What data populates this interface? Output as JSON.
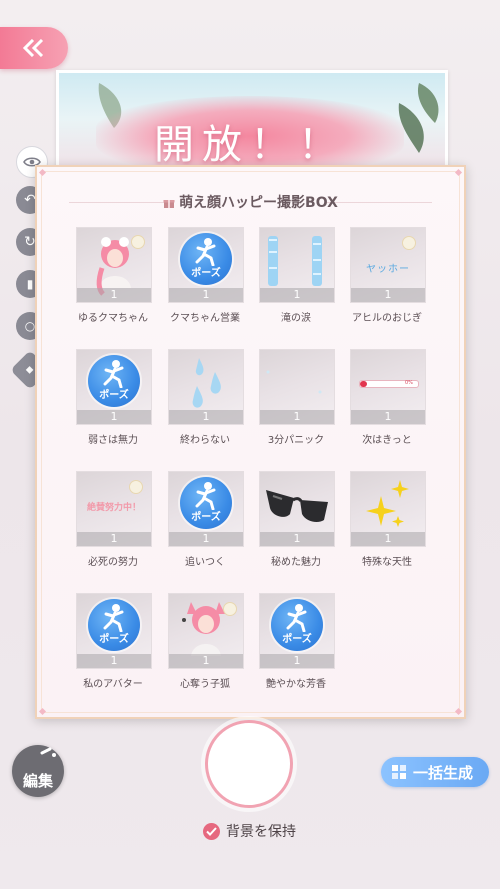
{
  "banner": {
    "text": "開放！！"
  },
  "panel": {
    "title": "萌え顔ハッピー撮影BOX"
  },
  "items": [
    {
      "label": "ゆるクマちゃん",
      "qty": "1"
    },
    {
      "label": "クマちゃん営業",
      "qty": "1",
      "pose": "ポーズ"
    },
    {
      "label": "滝の涙",
      "qty": "1"
    },
    {
      "label": "アヒルのおじぎ",
      "qty": "1",
      "art_text": "ヤッホー"
    },
    {
      "label": "弱さは無力",
      "qty": "1",
      "pose": "ポーズ"
    },
    {
      "label": "終わらない",
      "qty": "1"
    },
    {
      "label": "3分パニック",
      "qty": "1"
    },
    {
      "label": "次はきっと",
      "qty": "1",
      "art_text": "0%"
    },
    {
      "label": "必死の努力",
      "qty": "1",
      "art_text": "絶賛努力中！"
    },
    {
      "label": "追いつく",
      "qty": "1",
      "pose": "ポーズ"
    },
    {
      "label": "秘めた魅力",
      "qty": "1"
    },
    {
      "label": "特殊な天性",
      "qty": "1"
    },
    {
      "label": "私のアバター",
      "qty": "1",
      "pose": "ポーズ"
    },
    {
      "label": "心奪う子狐",
      "qty": "1"
    },
    {
      "label": "艶やかな芳香",
      "qty": "1",
      "pose": "ポーズ"
    }
  ],
  "bottom": {
    "edit_label": "編集",
    "batch_label": "一括生成",
    "keep_bg_label": "背景を保持"
  },
  "colors": {
    "accent_pink": "#f37a95",
    "pose_blue": "#3a8be6",
    "batch_blue": "#7ab4f8",
    "check_pink": "#e6687f"
  }
}
